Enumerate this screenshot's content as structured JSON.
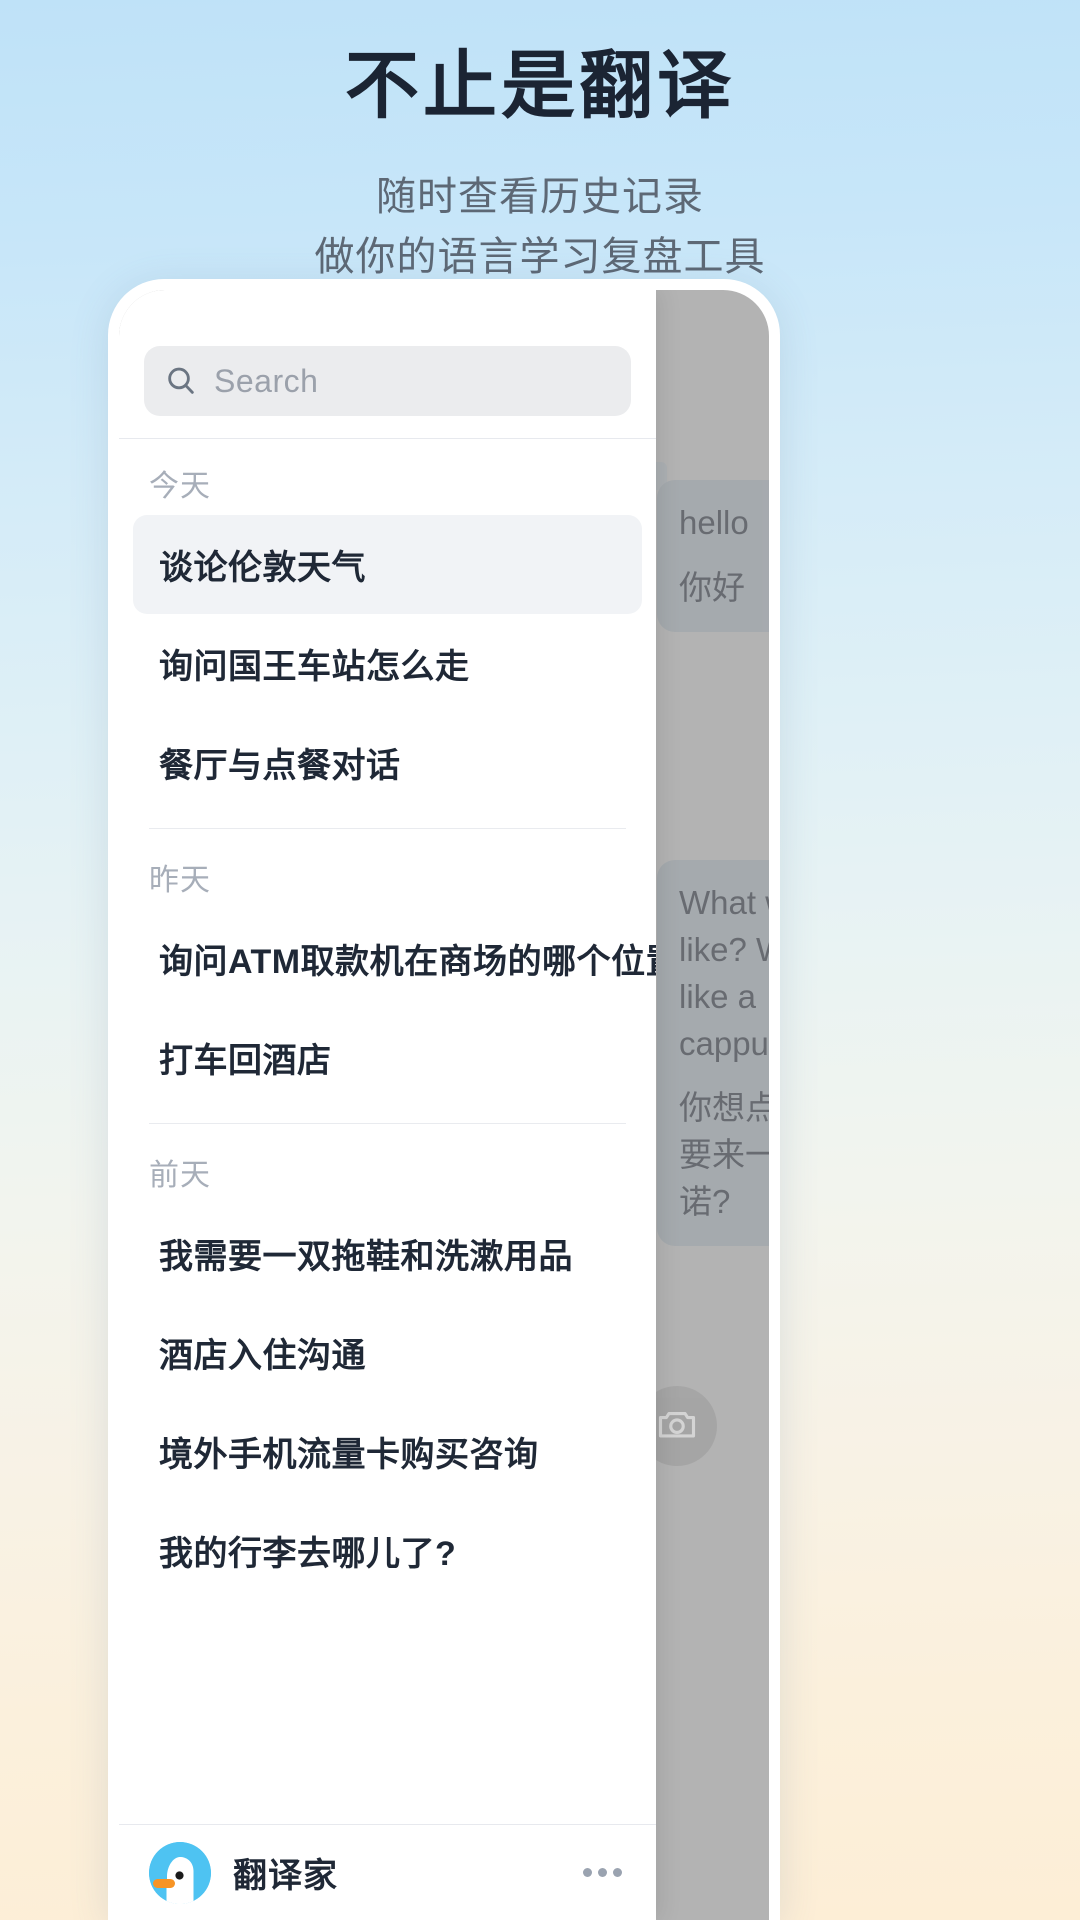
{
  "promo": {
    "headline": "不止是翻译",
    "subline_1": "随时查看历史记录",
    "subline_2": "做你的语言学习复盘工具"
  },
  "sidebar": {
    "search": {
      "placeholder": "Search",
      "value": "",
      "icon": "search-icon"
    },
    "groups": [
      {
        "label": "今天",
        "items": [
          {
            "title": "谈论伦敦天气",
            "active": true
          },
          {
            "title": "询问国王车站怎么走",
            "active": false
          },
          {
            "title": "餐厅与点餐对话",
            "active": false
          }
        ]
      },
      {
        "label": "昨天",
        "items": [
          {
            "title": "询问ATM取款机在商场的哪个位置",
            "active": false
          },
          {
            "title": "打车回酒店",
            "active": false
          }
        ]
      },
      {
        "label": "前天",
        "items": [
          {
            "title": "我需要一双拖鞋和洗漱用品",
            "active": false
          },
          {
            "title": "酒店入住沟通",
            "active": false
          },
          {
            "title": "境外手机流量卡购买咨询",
            "active": false
          },
          {
            "title": "我的行李去哪儿了?",
            "active": false
          }
        ]
      }
    ],
    "footer": {
      "brand_name": "翻译家",
      "logo_icon": "duck-bird-logo-icon",
      "more_icon": "more-ellipsis-icon"
    }
  },
  "chat_panel": {
    "bubbles": [
      {
        "source": "hello",
        "translation": "你好"
      },
      {
        "source": "What would you like? Would you like a cappuccino?",
        "translation": "你想点什么?要不要来一杯卡布基诺?"
      }
    ],
    "camera_icon": "camera-icon"
  },
  "colors": {
    "brand_blue": "#4ec3f2",
    "brand_orange": "#f79425",
    "text_dark": "#1f2836",
    "text_muted": "#a7aeb9",
    "active_row": "#f1f3f6"
  }
}
